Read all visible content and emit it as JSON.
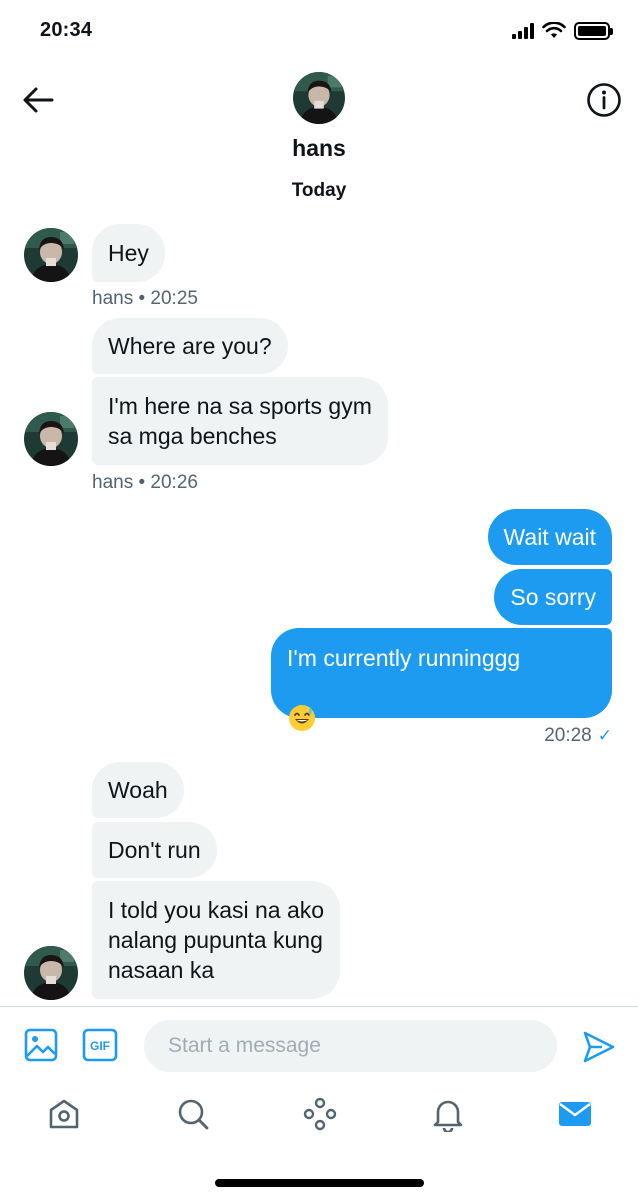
{
  "status_bar": {
    "time": "20:34"
  },
  "header": {
    "name": "hans",
    "day_label": "Today"
  },
  "messages": [
    {
      "text": "Hey"
    },
    {
      "meta": "hans  • 20:25"
    },
    {
      "text": "Where are you?"
    },
    {
      "text": "I'm here na sa sports gym\nsa mga benches"
    },
    {
      "meta": "hans  • 20:26"
    },
    {
      "text": "Wait wait"
    },
    {
      "text": "So sorry"
    },
    {
      "text": "I'm currently runninggg"
    },
    {
      "meta": "20:28"
    },
    {
      "text": "Woah"
    },
    {
      "text": "Don't run"
    },
    {
      "text": "I told you kasi na ako\nnalang pupunta kung\nnasaan ka"
    }
  ],
  "composer": {
    "placeholder": "Start a message",
    "gif_label": "GIF"
  },
  "tabs": [
    "home",
    "search",
    "spaces",
    "notifications",
    "messages"
  ],
  "colors": {
    "accent": "#1d9bf0",
    "incoming_bubble": "#eff3f4",
    "meta_text": "#536471"
  },
  "icons": [
    "back-arrow-icon",
    "info-icon",
    "image-icon",
    "gif-icon",
    "send-icon",
    "home-icon",
    "search-icon",
    "spaces-icon",
    "bell-icon",
    "mail-icon",
    "read-check-icon",
    "sweat-smile-emoji-icon"
  ]
}
